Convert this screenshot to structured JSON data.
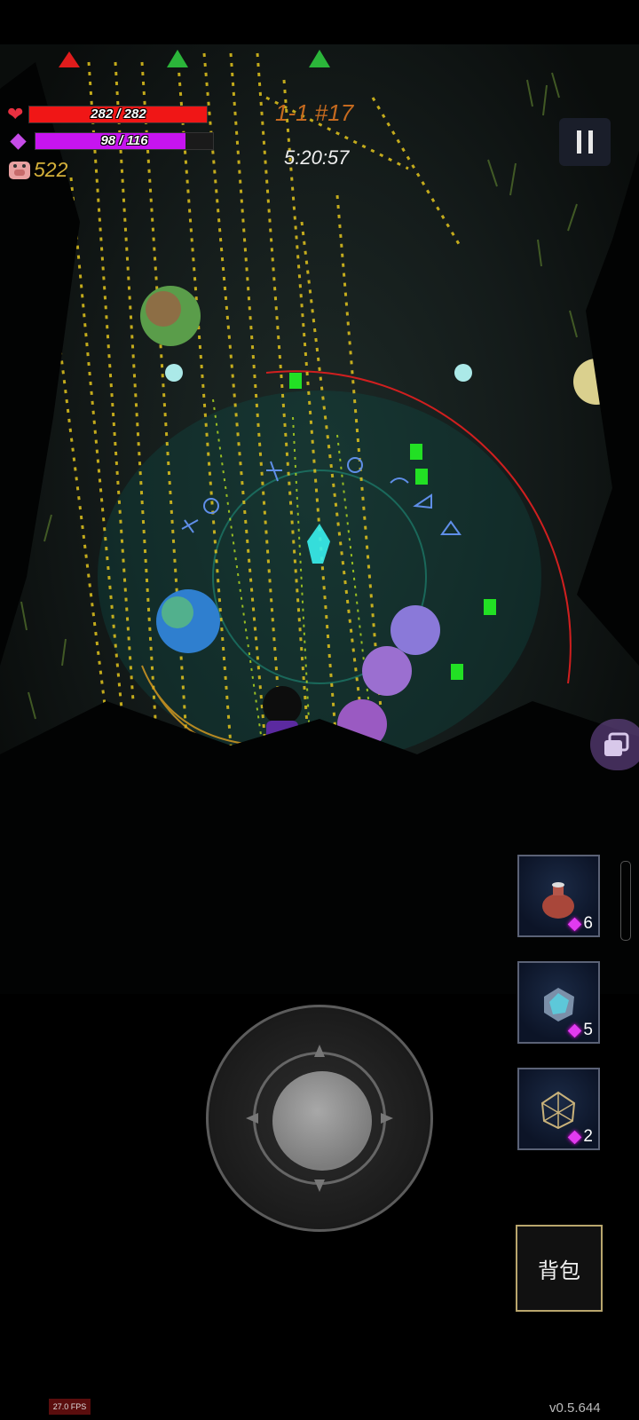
{
  "hud": {
    "hp_text": "282 / 282",
    "hp_value": 282,
    "hp_max": 282,
    "mp_text": "98 / 116",
    "mp_value": 98,
    "mp_max": 116,
    "gold": "522",
    "stage": "1-1 #17",
    "timer": "5:20:57"
  },
  "items": [
    {
      "icon": "potion-jar-icon",
      "count": "6"
    },
    {
      "icon": "crystal-orb-icon",
      "count": "5"
    },
    {
      "icon": "icosahedron-icon",
      "count": "2"
    }
  ],
  "bag_label": "背包",
  "fps": "27.0 FPS",
  "version": "v0.5.644",
  "colors": {
    "hp": "#f01616",
    "mp": "#c714f0",
    "gold": "#d4b03a",
    "stage": "#c56a1f"
  }
}
